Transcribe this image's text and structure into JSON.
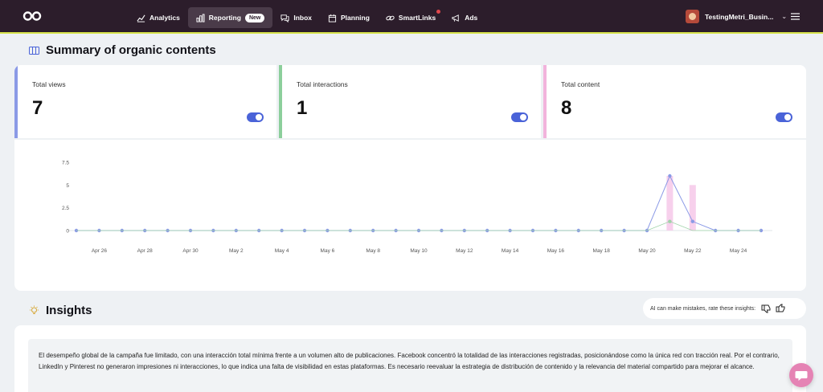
{
  "topbar": {
    "nav": [
      {
        "label": "Analytics",
        "icon": "analytics-icon"
      },
      {
        "label": "Reporting",
        "icon": "reporting-icon",
        "badge": "New",
        "active": true
      },
      {
        "label": "Inbox",
        "icon": "inbox-icon"
      },
      {
        "label": "Planning",
        "icon": "calendar-icon"
      },
      {
        "label": "SmartLinks",
        "icon": "link-icon",
        "notification": true
      },
      {
        "label": "Ads",
        "icon": "megaphone-icon"
      }
    ],
    "account_name": "TestingMetri_Busin..."
  },
  "summary": {
    "title": "Summary of organic contents",
    "metrics": [
      {
        "label": "Total views",
        "value": "7",
        "color": "#8b9ae6",
        "toggle_on": true
      },
      {
        "label": "Total interactions",
        "value": "1",
        "color": "#8ccf9b",
        "toggle_on": true
      },
      {
        "label": "Total content",
        "value": "8",
        "color": "#f2b3dc",
        "toggle_on": true
      }
    ]
  },
  "chart_data": {
    "type": "line",
    "y_ticks": [
      "7.5",
      "5",
      "2.5",
      "0"
    ],
    "ylim": [
      0,
      7.5
    ],
    "x": [
      "Apr 25",
      "Apr 26",
      "Apr 27",
      "Apr 28",
      "Apr 29",
      "Apr 30",
      "May 1",
      "May 2",
      "May 3",
      "May 4",
      "May 5",
      "May 6",
      "May 7",
      "May 8",
      "May 9",
      "May 10",
      "May 11",
      "May 12",
      "May 13",
      "May 14",
      "May 15",
      "May 16",
      "May 17",
      "May 18",
      "May 19",
      "May 20",
      "May 21",
      "May 22",
      "May 23",
      "May 24",
      "May 25"
    ],
    "x_tick_labels": [
      "Apr 26",
      "Apr 28",
      "Apr 30",
      "May 2",
      "May 4",
      "May 6",
      "May 8",
      "May 10",
      "May 12",
      "May 14",
      "May 16",
      "May 18",
      "May 20",
      "May 22",
      "May 24"
    ],
    "series": [
      {
        "values": [
          0,
          0,
          0,
          0,
          0,
          0,
          0,
          0,
          0,
          0,
          0,
          0,
          0,
          0,
          0,
          0,
          0,
          0,
          0,
          0,
          0,
          0,
          0,
          0,
          0,
          0,
          6,
          1,
          0,
          0,
          0
        ],
        "color": "#8b9ae6",
        "kind": "line"
      },
      {
        "values": [
          0,
          0,
          0,
          0,
          0,
          0,
          0,
          0,
          0,
          0,
          0,
          0,
          0,
          0,
          0,
          0,
          0,
          0,
          0,
          0,
          0,
          0,
          0,
          0,
          0,
          0,
          1,
          0,
          0,
          0,
          0
        ],
        "color": "#9fd3a8",
        "kind": "line"
      },
      {
        "values": [
          0,
          0,
          0,
          0,
          0,
          0,
          0,
          0,
          0,
          0,
          0,
          0,
          0,
          0,
          0,
          0,
          0,
          0,
          0,
          0,
          0,
          0,
          0,
          0,
          0,
          0,
          6,
          5,
          0,
          0,
          0
        ],
        "color": "#f7d0ec",
        "kind": "bar"
      }
    ]
  },
  "insights": {
    "title": "Insights",
    "ai_note": "AI can make mistakes, rate these insights:",
    "text": "El desempeño global de la campaña fue limitado, con una interacción total mínima frente a un volumen alto de publicaciones. Facebook concentró la totalidad de las interacciones registradas, posicionándose como la única red con tracción real. Por el contrario, LinkedIn y Pinterest no generaron impresiones ni interacciones, lo que indica una falta de visibilidad en estas plataformas. Es necesario reevaluar la estrategia de distribución de contenido y la relevancia del material compartido para mejorar el alcance."
  }
}
